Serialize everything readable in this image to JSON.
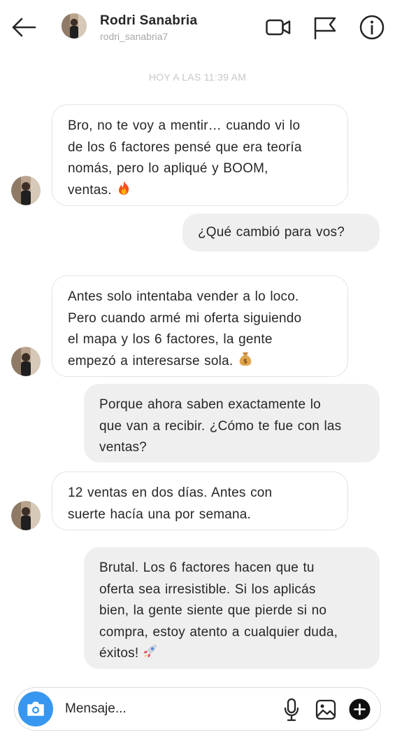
{
  "header": {
    "name": "Rodri Sanabria",
    "username": "rodri_sanabria7",
    "icons": [
      "back-arrow-icon",
      "video-call-icon",
      "flag-icon",
      "info-icon"
    ]
  },
  "timestamp": "HOY A LAS 11:39 AM",
  "messages": [
    {
      "from": "contact",
      "lines": [
        " Bro, no te voy a mentir… cuando vi lo",
        "de los 6 factores pensé que era teoría",
        "nomás, pero lo apliqué y BOOM,",
        "ventas."
      ],
      "emoji": "fire-emoji"
    },
    {
      "from": "me",
      "lines": [
        "¿Qué cambió para vos?"
      ]
    },
    {
      "from": "contact",
      "lines": [
        "Antes solo intentaba vender a lo loco.",
        "Pero cuando armé mi oferta siguiendo",
        "el mapa y los 6 factores, la gente",
        "empezó a interesarse sola."
      ],
      "emoji": "money-bag-emoji"
    },
    {
      "from": "me",
      "lines": [
        "Porque ahora saben exactamente lo",
        "que van a recibir. ¿Cómo te fue con las",
        "ventas?"
      ]
    },
    {
      "from": "contact",
      "lines": [
        "12 ventas en dos días. Antes con",
        "suerte hacía una por semana."
      ]
    },
    {
      "from": "me",
      "lines": [
        "Brutal. Los 6 factores hacen que tu",
        "oferta sea irresistible. Si los aplicás",
        "bien, la gente siente que pierde si no",
        "compra, estoy atento a cualquier duda,",
        "éxitos!"
      ],
      "emoji": "rocket-emoji"
    }
  ],
  "composer": {
    "placeholder": "Mensaje...",
    "icons": [
      "camera-icon",
      "microphone-icon",
      "gallery-icon",
      "plus-icon"
    ]
  },
  "colors": {
    "accent": "#3797f0",
    "sent_bubble": "#efefef",
    "received_border": "#e3e3e3",
    "muted_text": "#a8a8a8"
  }
}
